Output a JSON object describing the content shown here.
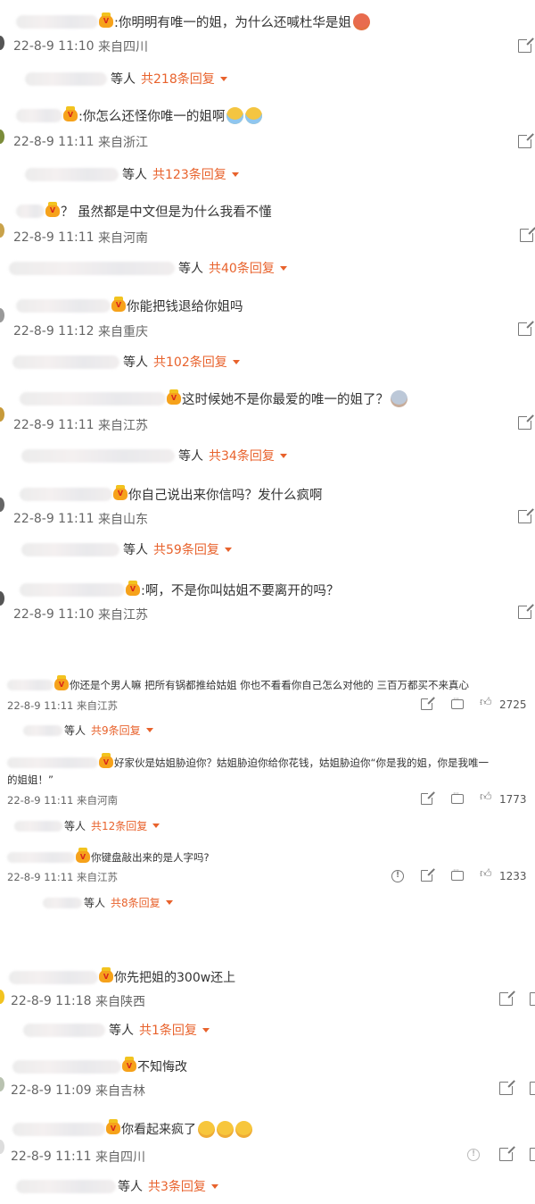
{
  "more_suffix": "等人",
  "threads": [
    {
      "text": ":你明明有唯一的姐，为什么还喊杜华是姐",
      "time": "22-8-9 11:10",
      "loc": "来自四川",
      "more": "共218条回复"
    },
    {
      "text": ":你怎么还怪你唯一的姐啊",
      "time": "22-8-9 11:11",
      "loc": "来自浙江",
      "more": "共123条回复"
    },
    {
      "text": "？ 虽然都是中文但是为什么我看不懂",
      "time": "22-8-9 11:11",
      "loc": "来自河南",
      "more": "共40条回复"
    },
    {
      "text": "你能把钱退给你姐吗",
      "time": "22-8-9 11:12",
      "loc": "来自重庆",
      "more": "共102条回复"
    },
    {
      "text": "这时候她不是你最爱的唯一的姐了？",
      "time": "22-8-9 11:11",
      "loc": "来自江苏",
      "more": "共34条回复"
    },
    {
      "text": "你自己说出来你信吗？发什么疯啊",
      "time": "22-8-9 11:11",
      "loc": "来自山东",
      "more": "共59条回复"
    },
    {
      "text": ":啊，不是你叫姑姐不要离开的吗？",
      "time": "22-8-9 11:10",
      "loc": "来自江苏",
      "more": ""
    }
  ],
  "small_threads": [
    {
      "text": "你还是个男人嘛 把所有锅都推给姑姐 你也不看看你自己怎么对他的 三百万都买不来真心",
      "text2": "",
      "time": "22-8-9 11:11",
      "loc": "来自江苏",
      "likes": "2725",
      "more": "共9条回复"
    },
    {
      "text": "好家伙是姑姐胁迫你？姑姐胁迫你给你花钱，姑姐胁迫你“你是我的姐，你是我唯一",
      "text2": "的姐姐！”",
      "time": "22-8-9 11:11",
      "loc": "来自河南",
      "likes": "1773",
      "more": "共12条回复"
    },
    {
      "text": "你键盘敲出来的是人字吗?",
      "text2": "",
      "time": "22-8-9 11:11",
      "loc": "来自江苏",
      "likes": "1233",
      "more": "共8条回复"
    }
  ],
  "bottom_threads": [
    {
      "text": "你先把姐的300w还上",
      "time": "22-8-9 11:18",
      "loc": "来自陕西",
      "more": "共1条回复"
    },
    {
      "text": "不知悔改",
      "time": "22-8-9 11:09",
      "loc": "来自吉林",
      "more": ""
    },
    {
      "text": "你看起来疯了",
      "time": "22-8-9 11:11",
      "loc": "来自四川",
      "more": "共3条回复"
    }
  ],
  "colors": {
    "accent": "#e8622c",
    "meta": "#666666"
  }
}
